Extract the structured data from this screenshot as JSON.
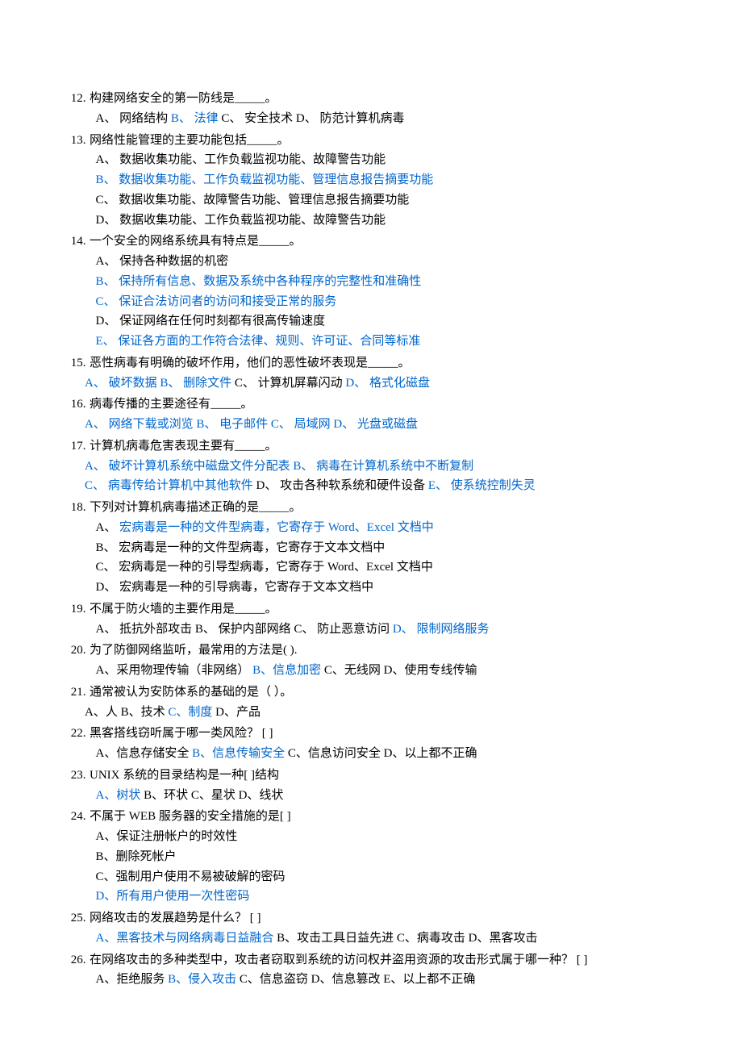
{
  "questions": [
    {
      "num": "12.",
      "stem": "构建网络安全的第一防线是_____。",
      "lines": [
        [
          {
            "t": "A、 网络结构 ",
            "hl": false
          },
          {
            "t": "B、 法律",
            "hl": true
          },
          {
            "t": " C、 安全技术 D、 防范计算机病毒",
            "hl": false
          }
        ]
      ]
    },
    {
      "num": "13.",
      "stem": "网络性能管理的主要功能包括_____。",
      "lines": [
        [
          {
            "t": "A、 数据收集功能、工作负载监视功能、故障警告功能",
            "hl": false
          }
        ],
        [
          {
            "t": "B、 数据收集功能、工作负载监视功能、管理信息报告摘要功能",
            "hl": true
          }
        ],
        [
          {
            "t": "C、 数据收集功能、故障警告功能、管理信息报告摘要功能",
            "hl": false
          }
        ],
        [
          {
            "t": "D、 数据收集功能、工作负载监视功能、故障警告功能",
            "hl": false
          }
        ]
      ]
    },
    {
      "num": "14.",
      "stem": "一个安全的网络系统具有特点是_____。",
      "lines": [
        [
          {
            "t": "A、 保持各种数据的机密",
            "hl": false
          }
        ],
        [
          {
            "t": "B、 保持所有信息、数据及系统中各种程序的完整性和准确性",
            "hl": true
          }
        ],
        [
          {
            "t": "C、 保证合法访问者的访问和接受正常的服务",
            "hl": true
          }
        ],
        [
          {
            "t": "D、 保证网络在任何时刻都有很高传输速度",
            "hl": false
          }
        ],
        [
          {
            "t": "E、 保证各方面的工作符合法律、规则、许可证、合同等标准",
            "hl": true
          }
        ]
      ]
    },
    {
      "num": "15.",
      "stem": "恶性病毒有明确的破坏作用，他们的恶性破坏表现是_____。",
      "lines": [
        [
          {
            "t": "A、 破坏数据",
            "hl": true
          },
          {
            "t": " ",
            "hl": false
          },
          {
            "t": "B、 删除文件",
            "hl": true
          },
          {
            "t": " C、 计算机屏幕闪动 ",
            "hl": false
          },
          {
            "t": "D、 格式化磁盘",
            "hl": true
          }
        ]
      ],
      "indent": "sm"
    },
    {
      "num": "16.",
      "stem": "病毒传播的主要途径有_____。",
      "lines": [
        [
          {
            "t": "A、 网络下载或浏览",
            "hl": true
          },
          {
            "t": " ",
            "hl": false
          },
          {
            "t": "B、 电子邮件",
            "hl": true
          },
          {
            "t": " ",
            "hl": false
          },
          {
            "t": "C、 局域网",
            "hl": true
          },
          {
            "t": " ",
            "hl": false
          },
          {
            "t": "D、 光盘或磁盘",
            "hl": true
          }
        ]
      ],
      "indent": "sm"
    },
    {
      "num": "17.",
      "stem": "计算机病毒危害表现主要有_____。",
      "lines": [
        [
          {
            "t": "A、 破坏计算机系统中磁盘文件分配表",
            "hl": true
          },
          {
            "t": " ",
            "hl": false
          },
          {
            "t": "B、 病毒在计算机系统中不断复制",
            "hl": true
          }
        ],
        [
          {
            "t": "C、 病毒传给计算机中其他软件",
            "hl": true
          },
          {
            "t": " D、 攻击各种软系统和硬件设备 ",
            "hl": false
          },
          {
            "t": "E、 使系统控制失灵",
            "hl": true
          }
        ]
      ],
      "indent": "sm"
    },
    {
      "num": "18.",
      "stem": "下列对计算机病毒描述正确的是_____。",
      "lines": [
        [
          {
            "t": "A、 ",
            "hl": false
          },
          {
            "t": "宏病毒是一种的文件型病毒，它寄存于 Word、Excel 文档中",
            "hl": true
          }
        ],
        [
          {
            "t": "B、 宏病毒是一种的文件型病毒，它寄存于文本文档中",
            "hl": false
          }
        ],
        [
          {
            "t": "C、 宏病毒是一种的引导型病毒，它寄存于 Word、Excel 文档中",
            "hl": false
          }
        ],
        [
          {
            "t": "D、 宏病毒是一种的引导病毒，它寄存于文本文档中",
            "hl": false
          }
        ]
      ]
    },
    {
      "num": "19.",
      "stem": "不属于防火墙的主要作用是_____。",
      "lines": [
        [
          {
            "t": "A、 抵抗外部攻击 B、 保护内部网络   C、 防止恶意访问   ",
            "hl": false
          },
          {
            "t": "D、 限制网络服务",
            "hl": true
          }
        ]
      ]
    },
    {
      "num": "20.",
      "stem": "为了防御网络监听，最常用的方法是(    ).",
      "lines": [
        [
          {
            "t": "A、采用物理传输（非网络） ",
            "hl": false
          },
          {
            "t": "B、信息加密",
            "hl": true
          },
          {
            "t": " C、无线网 D、使用专线传输",
            "hl": false
          }
        ]
      ]
    },
    {
      "num": "21.",
      "stem": "通常被认为安防体系的基础的是（    ）。",
      "lines": [
        [
          {
            "t": "A、人    B、技术    ",
            "hl": false
          },
          {
            "t": "C、制度",
            "hl": true
          },
          {
            "t": "    D、产品",
            "hl": false
          }
        ]
      ],
      "indent": "sm"
    },
    {
      "num": "22.",
      "stem": "黑客搭线窃听属于哪一类风险？ [    ]",
      "lines": [
        [
          {
            "t": "A、信息存储安全 ",
            "hl": false
          },
          {
            "t": "B、信息传输安全",
            "hl": true
          },
          {
            "t": " C、信息访问安全 D、以上都不正确",
            "hl": false
          }
        ]
      ]
    },
    {
      "num": "23.",
      "stem": "UNIX 系统的目录结构是一种[    ]结构",
      "lines": [
        [
          {
            "t": "A、树状",
            "hl": true
          },
          {
            "t": "        B、环状      C、星状        D、线状",
            "hl": false
          }
        ]
      ]
    },
    {
      "num": "24.",
      "stem": "不属于 WEB 服务器的安全措施的是[    ]",
      "lines": [
        [
          {
            "t": "A、保证注册帐户的时效性",
            "hl": false
          }
        ],
        [
          {
            "t": "B、删除死帐户",
            "hl": false
          }
        ],
        [
          {
            "t": "C、强制用户使用不易被破解的密码",
            "hl": false
          }
        ],
        [
          {
            "t": "D、所有用户使用一次性密码",
            "hl": true
          }
        ]
      ]
    },
    {
      "num": "25.",
      "stem": "网络攻击的发展趋势是什么？  [    ]",
      "lines": [
        [
          {
            "t": "A、黑客技术与网络病毒日益融合",
            "hl": true
          },
          {
            "t": " B、攻击工具日益先进 C、病毒攻击 D、黑客攻击",
            "hl": false
          }
        ]
      ]
    },
    {
      "num": "26.",
      "stem": "在网络攻击的多种类型中，攻击者窃取到系统的访问权并盗用资源的攻击形式属于哪一种？  [    ]",
      "lines": [
        [
          {
            "t": "A、拒绝服务 ",
            "hl": false
          },
          {
            "t": "B、侵入攻击",
            "hl": true
          },
          {
            "t": " C、信息盗窃 D、信息篡改 E、以上都不正确",
            "hl": false
          }
        ]
      ]
    }
  ]
}
